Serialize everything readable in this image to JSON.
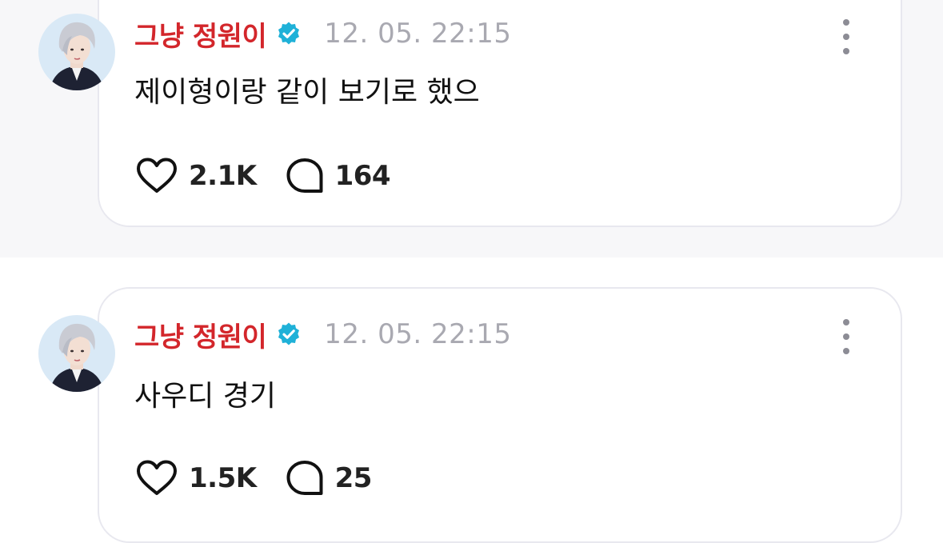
{
  "posts": [
    {
      "username": "그냥 정원이",
      "timestamp": "12. 05. 22:15",
      "text": "제이형이랑 같이 보기로 했으",
      "likes": "2.1K",
      "comments": "164"
    },
    {
      "username": "그냥 정원이",
      "timestamp": "12. 05. 22:15",
      "text": "사우디 경기",
      "likes": "1.5K",
      "comments": "25"
    }
  ],
  "colors": {
    "username": "#d3262b",
    "verified_badge": "#1fb1d8",
    "timestamp": "#a9a9b1",
    "card_border": "#e8e8ef",
    "background_band": "#f7f7f9"
  },
  "icons": {
    "verified": "verified-badge-icon",
    "more": "more-vertical-icon",
    "like": "heart-icon",
    "comment": "comment-bubble-icon"
  }
}
